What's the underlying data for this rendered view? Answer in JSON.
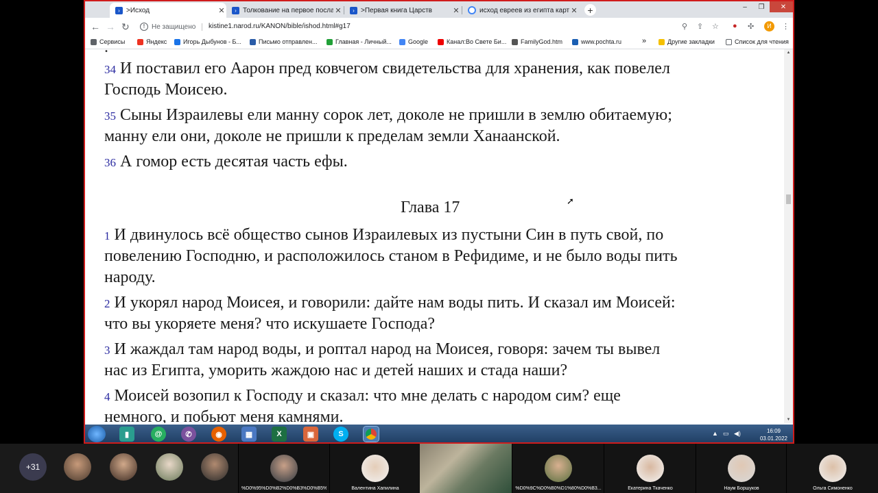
{
  "browser": {
    "tabs": [
      {
        "title": ">Исход",
        "active": true
      },
      {
        "title": "Толкование на первое послание",
        "active": false
      },
      {
        "title": ">Первая книга Царств",
        "active": false
      },
      {
        "title": "исход евреев из египта карта –",
        "active": false
      }
    ],
    "security": "Не защищено",
    "url": "kistine1.narod.ru/KANON/bible/ishod.html#g17",
    "profile_initial": "И"
  },
  "bookmarks": [
    {
      "label": "Сервисы",
      "color": "#5f6368"
    },
    {
      "label": "Яндекс",
      "color": "#e32"
    },
    {
      "label": "Игорь Дыбунов - Б...",
      "color": "#1a73e8"
    },
    {
      "label": "Письмо отправлен...",
      "color": "#2a5ca8"
    },
    {
      "label": "Главная - Личный...",
      "color": "#21a038"
    },
    {
      "label": "Google",
      "color": "#4285f4"
    },
    {
      "label": "Канал:Во Свете Би...",
      "color": "#e00"
    },
    {
      "label": "FamilyGod.htm",
      "color": "#555"
    },
    {
      "label": "www.pochta.ru",
      "color": "#1b5fb3"
    }
  ],
  "bookmarks_right": {
    "more": "»",
    "other": "Другие закладки",
    "reading": "Список для чтения"
  },
  "content": {
    "verses_before": [
      {
        "num": "34",
        "lines": [
          "И поставил его Аарон пред ковчегом свидетельства для хранения, как повелел",
          "Господь Моисею."
        ]
      },
      {
        "num": "35",
        "lines": [
          "Сыны Израилевы ели манну сорок лет, доколе не пришли в землю обитаемую;",
          "манну ели они, доколе не пришли к пределам земли Ханаанской."
        ]
      },
      {
        "num": "36",
        "lines": [
          "А гомор есть десятая часть ефы."
        ]
      }
    ],
    "chapter_title": "Глава 17",
    "verses": [
      {
        "num": "1",
        "lines": [
          "И двинулось всё общество сынов Израилевых из пустыни Син в путь свой, по",
          "повелению Господню, и расположилось станом в Рефидиме, и не было воды пить",
          "народу."
        ]
      },
      {
        "num": "2",
        "lines": [
          "И укорял народ Моисея, и говорили: дайте нам воды пить. И сказал им Моисей:",
          "что вы укоряете меня? что искушаете Господа?"
        ]
      },
      {
        "num": "3",
        "lines": [
          "И жаждал там народ воды, и роптал народ на Моисея, говоря: зачем ты вывел",
          "нас из Египта, уморить жаждою нас и детей наших и стада наши?"
        ]
      },
      {
        "num": "4",
        "lines": [
          "Моисей возопил к Господу и сказал: что мне делать с народом сим? еще",
          "немного, и побьют меня камнями."
        ]
      }
    ]
  },
  "taskbar": {
    "time": "16:09",
    "date": "03.01.2022"
  },
  "meeting": {
    "more_count": "+31",
    "participants": [
      {
        "name": "%D0%95%D0%B2%D0%B3%D0%B5%D0%B..."
      },
      {
        "name": "Валентина Хапилина"
      },
      {
        "name": "%D0%9C%D0%B0%D1%80%D0%B3..."
      },
      {
        "name": "Екатерина Ткаченко"
      },
      {
        "name": "Наум Боршуков"
      },
      {
        "name": "Ольга Симоненко"
      }
    ]
  }
}
